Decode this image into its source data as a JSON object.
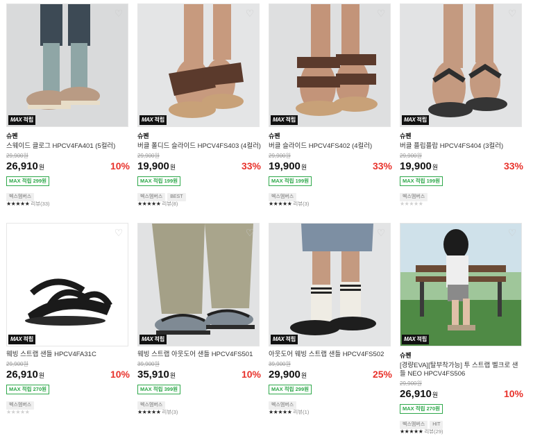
{
  "products": [
    {
      "brand": "슈펜",
      "name": "스웨이드 클로그 HPCV4FA401 (5컬러)",
      "original_price": "29,900원",
      "price": "26,910",
      "currency": "원",
      "discount": "10%",
      "reward": "MAX 적립 299원",
      "tags": [
        "벡스멤버스"
      ],
      "stars": "★★★★★",
      "review": "리뷰(33)",
      "badge_max": "MAX",
      "badge_text": "적립"
    },
    {
      "brand": "슈펜",
      "name": "버클 폴디드 슬라이드 HPCV4FS403 (4컬러)",
      "original_price": "29,900원",
      "price": "19,900",
      "currency": "원",
      "discount": "33%",
      "reward": "MAX 적립 199원",
      "tags": [
        "벡스멤버스",
        "BEST"
      ],
      "stars": "★★★★★",
      "review": "리뷰(8)",
      "badge_max": "MAX",
      "badge_text": "적립"
    },
    {
      "brand": "슈펜",
      "name": "버클 슬라이드 HPCV4FS402 (4컬러)",
      "original_price": "29,900원",
      "price": "19,900",
      "currency": "원",
      "discount": "33%",
      "reward": "MAX 적립 199원",
      "tags": [
        "벡스멤버스"
      ],
      "stars": "★★★★★",
      "review": "리뷰(3)",
      "badge_max": "MAX",
      "badge_text": "적립"
    },
    {
      "brand": "슈펜",
      "name": "버클 플립플랍 HPCV4FS404 (3컬러)",
      "original_price": "29,900원",
      "price": "19,900",
      "currency": "원",
      "discount": "33%",
      "reward": "MAX 적립 199원",
      "tags": [
        "벡스멤버스"
      ],
      "stars": "★★★★★",
      "review": "",
      "empty_stars": true,
      "badge_max": "MAX",
      "badge_text": "적립"
    },
    {
      "brand": "",
      "name": "웨빙 스트랩 샌들 HPCV4FA31C",
      "original_price": "29,900원",
      "price": "26,910",
      "currency": "원",
      "discount": "10%",
      "reward": "MAX 적립 270원",
      "tags": [
        "벡스멤버스"
      ],
      "stars": "★★★★★",
      "review": "",
      "empty_stars": true,
      "badge_max": "MAX",
      "badge_text": "적립"
    },
    {
      "brand": "",
      "name": "웨빙 스트랩 아웃도어 샌들 HPCV4FS501",
      "original_price": "39,900원",
      "price": "35,910",
      "currency": "원",
      "discount": "10%",
      "reward": "MAX 적립 399원",
      "tags": [
        "벡스멤버스"
      ],
      "stars": "★★★★★",
      "review": "리뷰(3)",
      "badge_max": "MAX",
      "badge_text": "적립"
    },
    {
      "brand": "",
      "name": "아웃도어 웨빙 스트랩 샌들 HPCV4FS502",
      "original_price": "39,900원",
      "price": "29,900",
      "currency": "원",
      "discount": "25%",
      "reward": "MAX 적립 299원",
      "tags": [
        "벡스멤버스"
      ],
      "stars": "★★★★★",
      "review": "리뷰(1)",
      "badge_max": "MAX",
      "badge_text": "적립"
    },
    {
      "brand": "슈펜",
      "name": "[경량EVA][탈부착가능] 투 스트랩 벨크로 샌들 NEO HPCV4FS506",
      "original_price": "29,900원",
      "price": "26,910",
      "currency": "원",
      "discount": "10%",
      "reward": "MAX 적립 270원",
      "tags": [
        "벡스멤버스",
        "HIT"
      ],
      "stars": "★★★★★",
      "review": "리뷰(29)",
      "badge_max": "MAX",
      "badge_text": "적립"
    }
  ],
  "heart_icon": "heart-icon",
  "colors": {
    "discount": "#e8322b",
    "reward": "#2ea84a",
    "badge": "#111111"
  }
}
